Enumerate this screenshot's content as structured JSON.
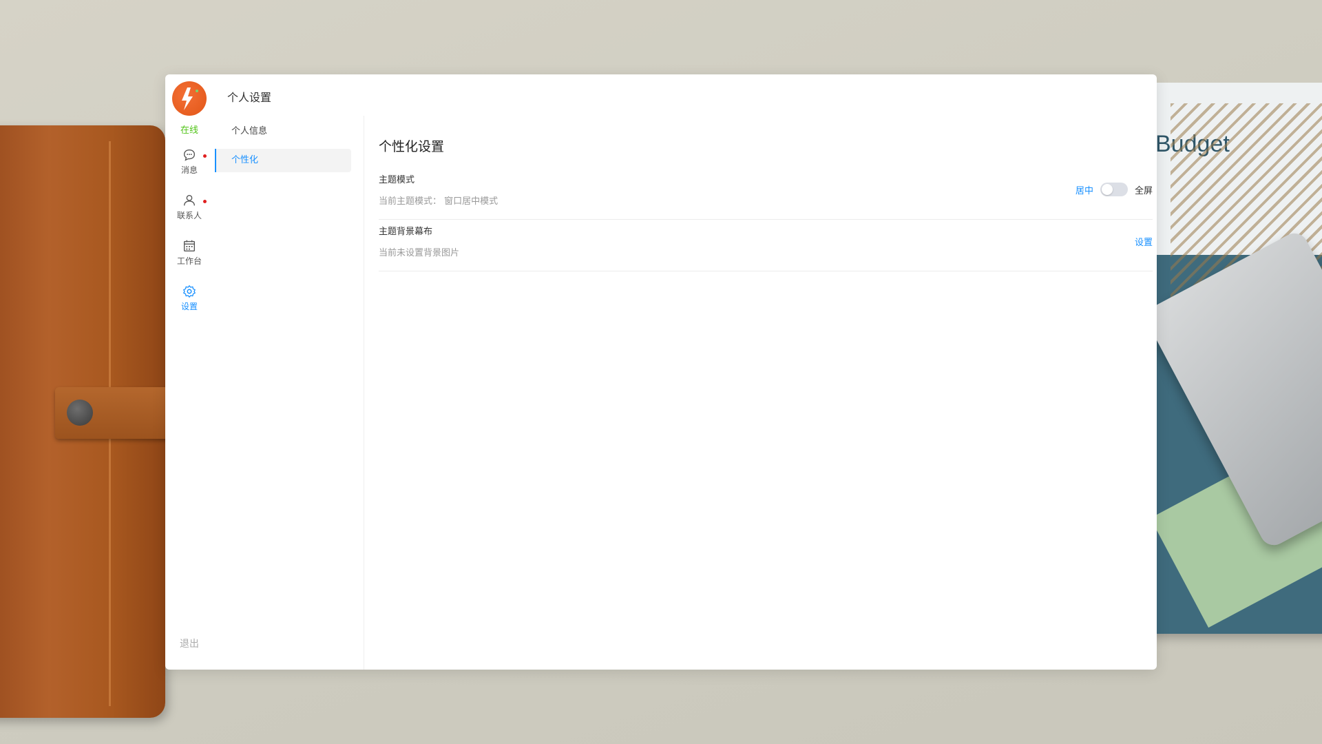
{
  "background": {
    "paper_heading": "Budget"
  },
  "rail": {
    "status": "在线",
    "items": [
      {
        "label": "消息",
        "icon": "chat-icon",
        "badge": true
      },
      {
        "label": "联系人",
        "icon": "user-icon",
        "badge": true
      },
      {
        "label": "工作台",
        "icon": "calendar-icon",
        "badge": false
      },
      {
        "label": "设置",
        "icon": "gear-icon",
        "badge": false,
        "active": true
      }
    ],
    "logout": "退出"
  },
  "header": {
    "title": "个人设置"
  },
  "subnav": {
    "items": [
      {
        "label": "个人信息",
        "active": false
      },
      {
        "label": "个性化",
        "active": true
      }
    ]
  },
  "content": {
    "title": "个性化设置",
    "theme_mode": {
      "title": "主题模式",
      "desc": "当前主题模式： 窗口居中模式",
      "option_left": "居中",
      "option_right": "全屏",
      "toggle_on": false
    },
    "theme_background": {
      "title": "主题背景幕布",
      "desc": "当前未设置背景图片",
      "action": "设置"
    }
  },
  "colors": {
    "accent": "#1890ff",
    "online": "#52c41a",
    "badge": "#e02020",
    "avatar": "#e85a1b"
  }
}
